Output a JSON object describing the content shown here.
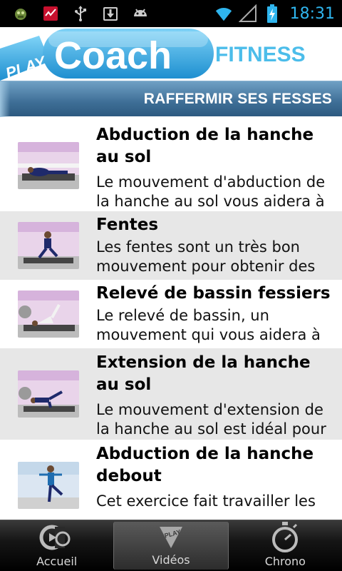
{
  "status_bar": {
    "time": "18:31",
    "icons": [
      "app-icon",
      "activity-icon",
      "usb-icon",
      "download-icon",
      "android-icon",
      "wifi-icon",
      "signal-icon",
      "battery-charging-icon"
    ]
  },
  "logo": {
    "play": "PLAY",
    "coach": "Coach",
    "fitness": "FITNESS"
  },
  "header": {
    "title": "RAFFERMIR SES FESSES"
  },
  "exercises": [
    {
      "title": "Abduction de la hanche au sol",
      "description": "Le mouvement d'abduction de la hanche au sol vous aidera à",
      "thumbnail": "abduction-floor-thumbnail"
    },
    {
      "title": "Fentes",
      "description": "Les fentes sont un très bon mouvement pour obtenir des",
      "thumbnail": "lunges-thumbnail"
    },
    {
      "title": "Relevé de bassin fessiers",
      "description": "Le relevé de bassin, un mouvement qui vous aidera à",
      "thumbnail": "pelvic-lift-thumbnail"
    },
    {
      "title": "Extension de la hanche au sol",
      "description": "Le mouvement d'extension de la hanche au sol est idéal pour",
      "thumbnail": "hip-extension-thumbnail"
    },
    {
      "title": "Abduction de la hanche debout",
      "description": "Cet exercice fait travailler les",
      "thumbnail": "standing-abduction-thumbnail"
    }
  ],
  "tabs": [
    {
      "label": "Accueil",
      "icon": "home-coach-icon",
      "active": false
    },
    {
      "label": "Vidéos",
      "icon": "play-video-icon",
      "active": true
    },
    {
      "label": "Chrono",
      "icon": "stopwatch-icon",
      "active": false
    }
  ],
  "colors": {
    "title_bar": "#3e6e96",
    "logo_blue": "#3fa9dc",
    "clock": "#2fb5ee",
    "alt_row": "#e7e7e7"
  }
}
